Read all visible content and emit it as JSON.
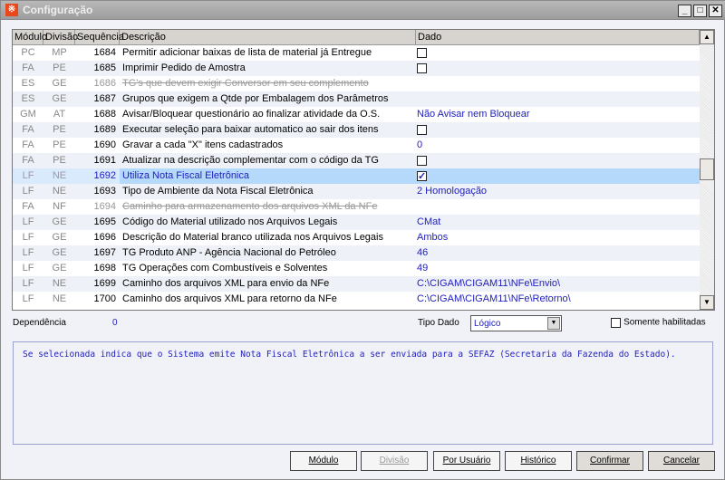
{
  "window": {
    "title": "Configuração",
    "icon": "app-icon"
  },
  "columns": [
    "Módulo",
    "Divisão",
    "Sequência",
    "Descrição",
    "Dado"
  ],
  "rows": [
    {
      "modulo": "PC",
      "divisao": "MP",
      "seq": "1684",
      "descricao": "Permitir adicionar baixas de lista de material já Entregue",
      "dado_type": "checkbox",
      "checked": false
    },
    {
      "modulo": "FA",
      "divisao": "PE",
      "seq": "1685",
      "descricao": "Imprimir Pedido de Amostra",
      "dado_type": "checkbox",
      "checked": false
    },
    {
      "modulo": "ES",
      "divisao": "GE",
      "seq": "1686",
      "descricao": "TG's que devem exigir Conversor em seu complemento",
      "dado_type": "none",
      "disabled": true
    },
    {
      "modulo": "ES",
      "divisao": "GE",
      "seq": "1687",
      "descricao": "Grupos que exigem a Qtde por Embalagem dos Parâmetros",
      "dado_type": "none"
    },
    {
      "modulo": "GM",
      "divisao": "AT",
      "seq": "1688",
      "descricao": "Avisar/Bloquear questionário ao finalizar atividade da O.S.",
      "dado_type": "text",
      "dado": "Não Avisar nem Bloquear"
    },
    {
      "modulo": "FA",
      "divisao": "PE",
      "seq": "1689",
      "descricao": "Executar seleção para baixar automatico ao sair dos itens",
      "dado_type": "checkbox",
      "checked": false
    },
    {
      "modulo": "FA",
      "divisao": "PE",
      "seq": "1690",
      "descricao": "Gravar a cada \"X\" itens cadastrados",
      "dado_type": "text",
      "dado": "0"
    },
    {
      "modulo": "FA",
      "divisao": "PE",
      "seq": "1691",
      "descricao": "Atualizar na descrição complementar com o código da TG",
      "dado_type": "checkbox",
      "checked": false
    },
    {
      "modulo": "LF",
      "divisao": "NE",
      "seq": "1692",
      "descricao": "Utiliza Nota Fiscal Eletrônica",
      "dado_type": "checkbox",
      "checked": true,
      "selected": true
    },
    {
      "modulo": "LF",
      "divisao": "NE",
      "seq": "1693",
      "descricao": "Tipo de Ambiente da Nota Fiscal Eletrônica",
      "dado_type": "text",
      "dado": "2 Homologação"
    },
    {
      "modulo": "FA",
      "divisao": "NF",
      "seq": "1694",
      "descricao": "Caminho para armazenamento dos arquivos XML da NFe",
      "dado_type": "none",
      "disabled": true
    },
    {
      "modulo": "LF",
      "divisao": "GE",
      "seq": "1695",
      "descricao": "Código do Material utilizado nos Arquivos Legais",
      "dado_type": "text",
      "dado": "CMat"
    },
    {
      "modulo": "LF",
      "divisao": "GE",
      "seq": "1696",
      "descricao": "Descrição do Material branco utilizada nos Arquivos Legais",
      "dado_type": "text",
      "dado": "Ambos"
    },
    {
      "modulo": "LF",
      "divisao": "GE",
      "seq": "1697",
      "descricao": "TG Produto ANP - Agência Nacional do Petróleo",
      "dado_type": "text",
      "dado": "46"
    },
    {
      "modulo": "LF",
      "divisao": "GE",
      "seq": "1698",
      "descricao": "TG Operações com Combustíveis e Solventes",
      "dado_type": "text",
      "dado": "49"
    },
    {
      "modulo": "LF",
      "divisao": "NE",
      "seq": "1699",
      "descricao": "Caminho dos arquivos XML para envio da NFe",
      "dado_type": "text",
      "dado": "C:\\CIGAM\\CIGAM11\\NFe\\Envio\\"
    },
    {
      "modulo": "LF",
      "divisao": "NE",
      "seq": "1700",
      "descricao": "Caminho dos arquivos XML para retorno da NFe",
      "dado_type": "text",
      "dado": "C:\\CIGAM\\CIGAM11\\NFe\\Retorno\\"
    }
  ],
  "scroll_position": 0.5,
  "dependencia": {
    "label": "Dependência",
    "value": "0"
  },
  "tipo_dado": {
    "label": "Tipo Dado",
    "value": "Lógico"
  },
  "somente_habilitadas": {
    "label": "Somente habilitadas",
    "checked": false
  },
  "description_text": "Se selecionada indica que o Sistema emite Nota Fiscal Eletrônica a ser enviada para a SEFAZ (Secretaria da Fazenda do Estado).",
  "buttons": {
    "modulo": "Módulo",
    "divisao": "Divisão",
    "por_usuario": "Por Usuário",
    "historico": "Histórico",
    "confirmar": "Confirmar",
    "cancelar": "Cancelar"
  },
  "colors": {
    "accent": "#2020c0",
    "selection": "#b5d9fb"
  }
}
